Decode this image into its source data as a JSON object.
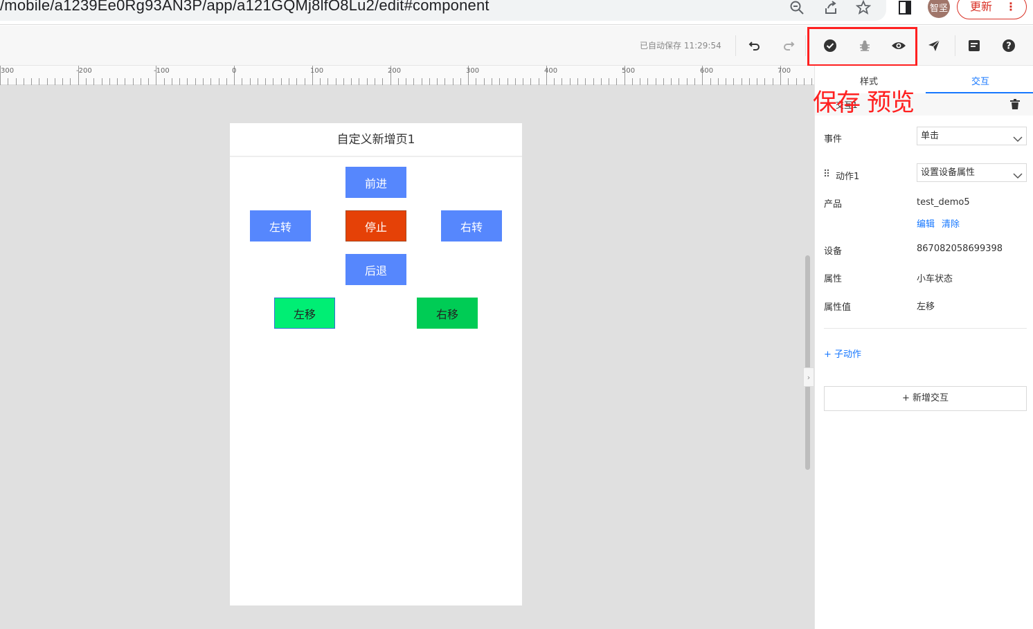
{
  "browser": {
    "url": "/mobile/a1239Ee0Rg93AN3P/app/a121GQMj8lfO8Lu2/edit#component",
    "avatar_text": "智坚",
    "update_label": "更新",
    "update_menu": "⋮"
  },
  "toolbar": {
    "autosave": "已自动保存 11:29:54"
  },
  "annotation": {
    "text": "保存 预览",
    "color": "#ff2020"
  },
  "ruler": {
    "labels": [
      "300",
      "-200",
      "-100",
      "0",
      "100",
      "200",
      "300",
      "400",
      "500",
      "600",
      "700"
    ]
  },
  "phone": {
    "title": "自定义新增页1",
    "buttons": {
      "forward": "前进",
      "left_turn": "左转",
      "stop": "停止",
      "right_turn": "右转",
      "back": "后退",
      "left_move": "左移",
      "right_move": "右移"
    },
    "colors": {
      "blue": "#5687fd",
      "stop": "#e54107",
      "green_light": "#00ee74",
      "green": "#00cc55"
    }
  },
  "panel": {
    "tabs": [
      "样式",
      "交互"
    ],
    "active_tab": "交互",
    "group_label": "交互1",
    "event_label": "事件",
    "event_value": "单击",
    "action_label": "动作1",
    "action_value": "设置设备属性",
    "product_label": "产品",
    "product_value": "test_demo5",
    "edit_link": "编辑",
    "clear_link": "清除",
    "device_label": "设备",
    "device_value": "867082058699398",
    "property_label": "属性",
    "property_value": "小车状态",
    "property_value_label": "属性值",
    "property_value_value": "左移",
    "add_sub_action": "+ 子动作",
    "add_interaction": "+ 新增交互"
  }
}
